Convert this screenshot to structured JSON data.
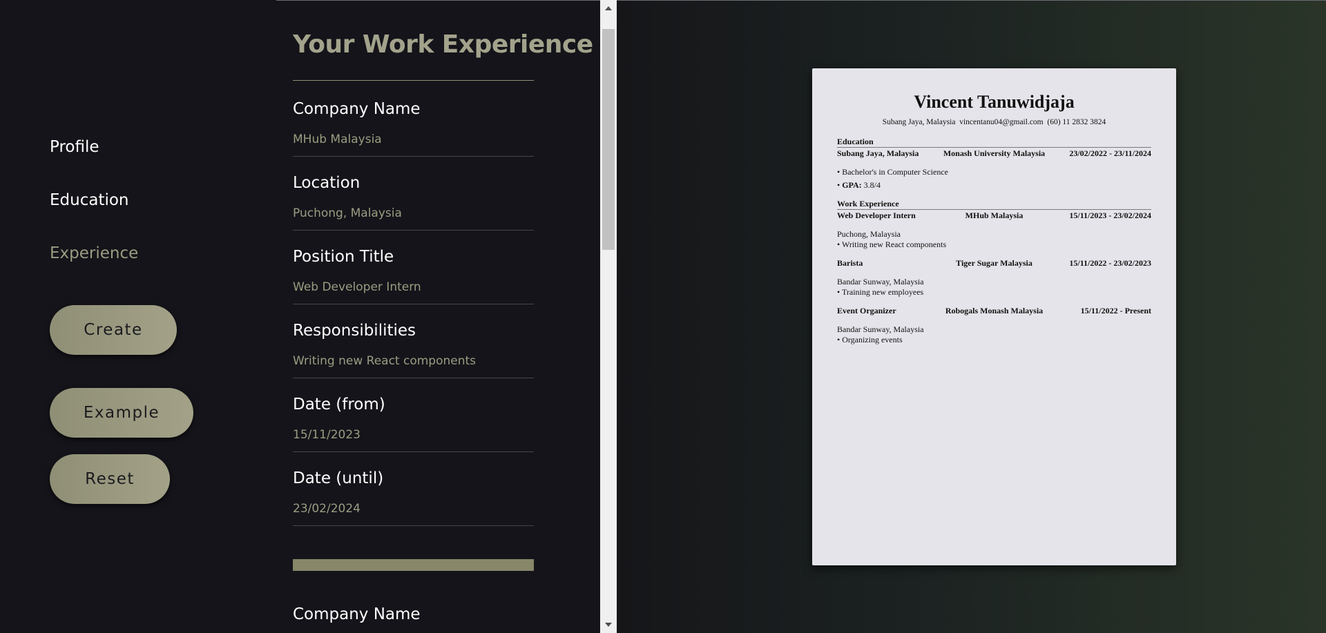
{
  "nav": {
    "items": [
      {
        "label": "Profile",
        "active": false
      },
      {
        "label": "Education",
        "active": false
      },
      {
        "label": "Experience",
        "active": true
      }
    ],
    "buttons": {
      "create": "Create",
      "example": "Example",
      "reset": "Reset"
    }
  },
  "form": {
    "title": "Your Work Experience",
    "fields": [
      {
        "label": "Company Name",
        "value": "MHub Malaysia"
      },
      {
        "label": "Location",
        "value": "Puchong, Malaysia"
      },
      {
        "label": "Position Title",
        "value": "Web Developer Intern"
      },
      {
        "label": "Responsibilities",
        "value": "Writing new React components"
      },
      {
        "label": "Date (from)",
        "value": "15/11/2023"
      },
      {
        "label": "Date (until)",
        "value": "23/02/2024"
      }
    ],
    "next_label": "Company Name"
  },
  "resume": {
    "name": "Vincent Tanuwidjaja",
    "contact": "Subang Jaya, Malaysia  vincentanu04@gmail.com  (60) 11 2832 3824",
    "education_heading": "Education",
    "education": {
      "location": "Subang Jaya, Malaysia",
      "school": "Monash University Malaysia",
      "dates": "23/02/2022 - 23/11/2024",
      "degree": "• Bachelor's in Computer Science",
      "gpa_prefix": "• ",
      "gpa_label": "GPA:",
      "gpa_value": " 3.8/4"
    },
    "work_heading": "Work Experience",
    "jobs": [
      {
        "title": "Web Developer Intern",
        "company": "MHub Malaysia",
        "dates": "15/11/2023 - 23/02/2024",
        "location": "Puchong, Malaysia",
        "duty": "• Writing new React components"
      },
      {
        "title": "Barista",
        "company": "Tiger Sugar Malaysia",
        "dates": "15/11/2022 - 23/02/2023",
        "location": "Bandar Sunway, Malaysia",
        "duty": "• Training new employees"
      },
      {
        "title": "Event Organizer",
        "company": "Robogals Monash Malaysia",
        "dates": "15/11/2022 - Present",
        "location": "Bandar Sunway, Malaysia",
        "duty": "• Organizing events"
      }
    ]
  },
  "colors": {
    "accent": "#9c9c82",
    "button": "#98977e",
    "background": "#14141a",
    "paper": "#e4e4ea"
  }
}
